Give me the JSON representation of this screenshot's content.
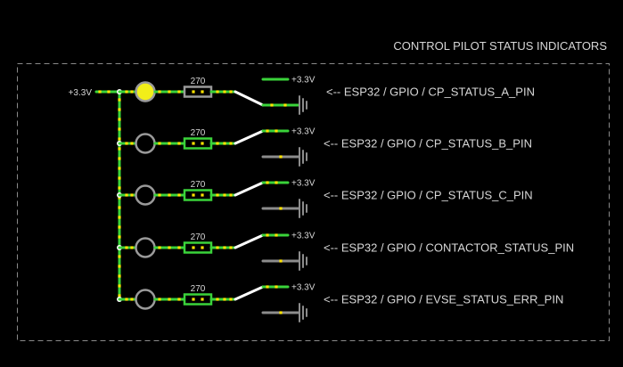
{
  "title": "CONTROL PILOT STATUS INDICATORS",
  "supply_label": "+3.3V",
  "colors": {
    "background": "#000000",
    "wire_on": "#3ad33a",
    "wire_off": "#8c8c8c",
    "switch_arm": "#ffffff",
    "node": "#ffe400",
    "led_on": "#f2ee19",
    "led_off": "#000000",
    "led_ring": "#9a9a9a",
    "text": "#d7d7d7"
  },
  "channels": [
    {
      "resistor": "270",
      "rail_label": "+3.3V",
      "pin_label": "<-- ESP32 / GPIO / CP_STATUS_A_PIN",
      "switch_state": "down",
      "led_lit": true
    },
    {
      "resistor": "270",
      "rail_label": "+3.3V",
      "pin_label": "<-- ESP32 / GPIO / CP_STATUS_B_PIN",
      "switch_state": "up",
      "led_lit": false
    },
    {
      "resistor": "270",
      "rail_label": "+3.3V",
      "pin_label": "<-- ESP32 / GPIO / CP_STATUS_C_PIN",
      "switch_state": "up",
      "led_lit": false
    },
    {
      "resistor": "270",
      "rail_label": "+3.3V",
      "pin_label": "<-- ESP32 / GPIO / CONTACTOR_STATUS_PIN",
      "switch_state": "up",
      "led_lit": false
    },
    {
      "resistor": "270",
      "rail_label": "+3.3V",
      "pin_label": "<-- ESP32 / GPIO / EVSE_STATUS_ERR_PIN",
      "switch_state": "up",
      "led_lit": false
    }
  ]
}
